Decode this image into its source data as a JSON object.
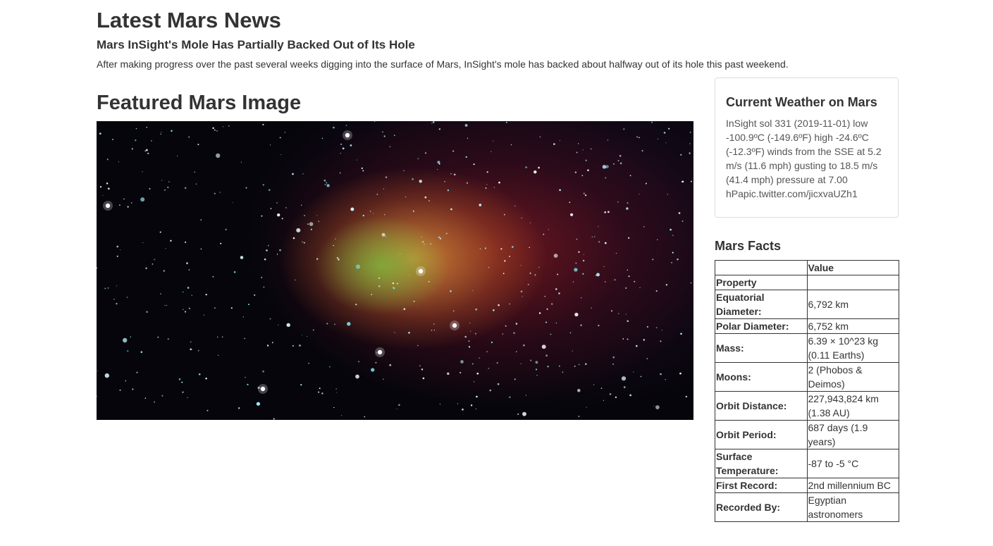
{
  "news": {
    "section_title": "Latest Mars News",
    "headline": "Mars InSight's Mole Has Partially Backed Out of Its Hole",
    "teaser": "After making progress over the past several weeks digging into the surface of Mars, InSight's mole has backed about halfway out of its hole this past weekend."
  },
  "featured": {
    "section_title": "Featured Mars Image"
  },
  "weather": {
    "title": "Current Weather on Mars",
    "text": "InSight sol 331 (2019-11-01) low -100.9ºC (-149.6ºF) high -24.6ºC (-12.3ºF) winds from the SSE at 5.2 m/s (11.6 mph) gusting to 18.5 m/s (41.4 mph) pressure at 7.00 hPapic.twitter.com/jicxvaUZh1"
  },
  "facts": {
    "title": "Mars Facts",
    "header": [
      "",
      "Value"
    ],
    "rows": [
      [
        "Property",
        ""
      ],
      [
        "Equatorial Diameter:",
        "6,792 km"
      ],
      [
        "Polar Diameter:",
        "6,752 km"
      ],
      [
        "Mass:",
        "6.39 × 10^23 kg (0.11 Earths)"
      ],
      [
        "Moons:",
        "2 (Phobos & Deimos)"
      ],
      [
        "Orbit Distance:",
        "227,943,824 km (1.38 AU)"
      ],
      [
        "Orbit Period:",
        "687 days (1.9 years)"
      ],
      [
        "Surface Temperature:",
        "-87 to -5 °C"
      ],
      [
        "First Record:",
        "2nd millennium BC"
      ],
      [
        "Recorded By:",
        "Egyptian astronomers"
      ]
    ]
  }
}
